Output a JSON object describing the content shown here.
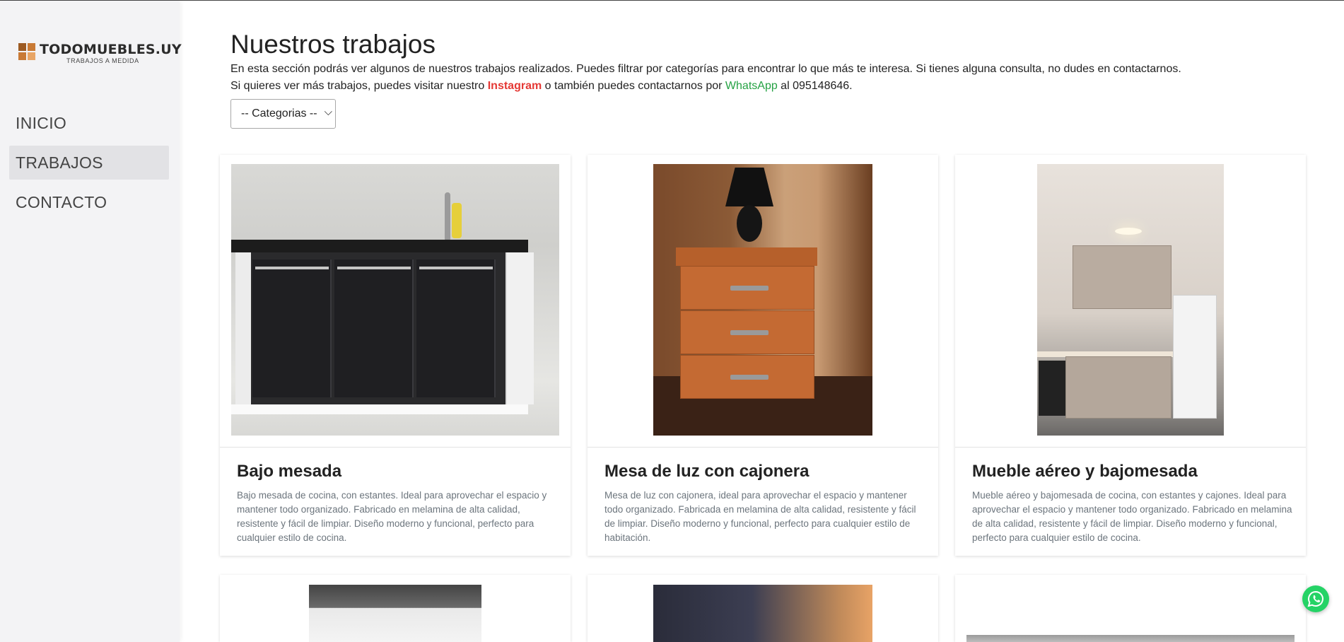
{
  "brand": {
    "name": "TODOMUEBLES.UY",
    "tagline": "TRABAJOS A MEDIDA"
  },
  "nav": [
    {
      "label": "INICIO",
      "active": false
    },
    {
      "label": "TRABAJOS",
      "active": true
    },
    {
      "label": "CONTACTO",
      "active": false
    }
  ],
  "page": {
    "title": "Nuestros trabajos",
    "intro_1": "En esta sección podrás ver algunos de nuestros trabajos realizados. Puedes filtrar por categorías para encontrar lo que más te interesa. Si tienes alguna consulta, no dudes en contactarnos.",
    "intro_2_a": "Si quieres ver más trabajos, puedes visitar nuestro ",
    "instagram_link": "Instagram",
    "intro_2_b": " o también puedes contactarnos por ",
    "whatsapp_link": "WhatsApp",
    "intro_2_c": " al 095148646."
  },
  "filter": {
    "selected": "-- Categorias --"
  },
  "cards": [
    {
      "title": "Bajo mesada",
      "desc": "Bajo mesada de cocina, con estantes. Ideal para aprovechar el espacio y mantener todo organizado. Fabricado en melamina de alta calidad, resistente y fácil de limpiar. Diseño moderno y funcional, perfecto para cualquier estilo de cocina."
    },
    {
      "title": "Mesa de luz con cajonera",
      "desc": "Mesa de luz con cajonera, ideal para aprovechar el espacio y mantener todo organizado. Fabricada en melamina de alta calidad, resistente y fácil de limpiar. Diseño moderno y funcional, perfecto para cualquier estilo de habitación."
    },
    {
      "title": "Mueble aéreo y bajomesada",
      "desc": "Mueble aéreo y bajomesada de cocina, con estantes y cajones. Ideal para aprovechar el espacio y mantener todo organizado. Fabricado en melamina de alta calidad, resistente y fácil de limpiar. Diseño moderno y funcional, perfecto para cualquier estilo de cocina."
    }
  ],
  "colors": {
    "instagram": "#e53935",
    "whatsapp": "#25a244",
    "whatsapp_button": "#25d366",
    "sidebar_bg": "#f3f3f5"
  },
  "icons": {
    "whatsapp_button": "whatsapp-icon",
    "logo": "logo-squares-icon"
  }
}
